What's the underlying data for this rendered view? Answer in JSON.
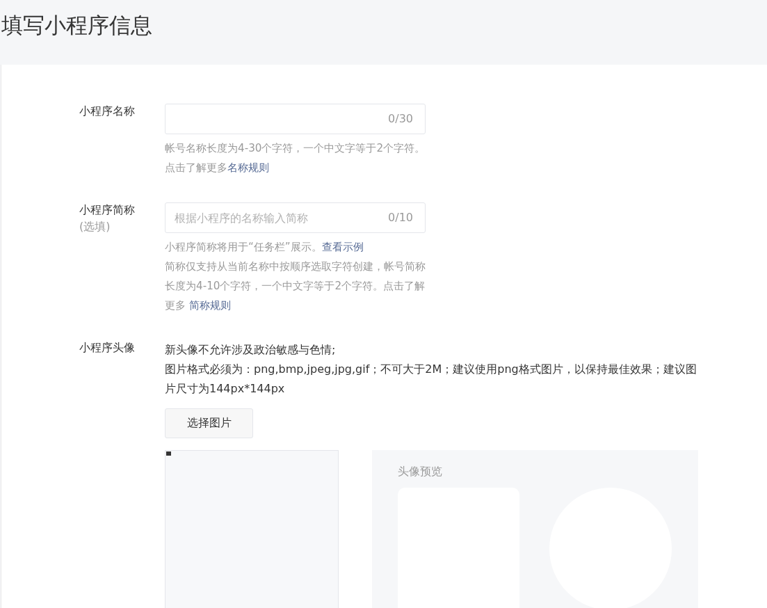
{
  "page_title": "填写小程序信息",
  "fields": [
    {
      "label": "小程序名称",
      "counter": "0/30",
      "hints": [
        {
          "text": "帐号名称长度为4-30个字符，一个中文字等于2个字符。点击了解更多",
          "link": "名称规则"
        }
      ]
    },
    {
      "label": "小程序简称",
      "sublabel": "(选填)",
      "placeholder": "根据小程序的名称输入简称",
      "counter": "0/10",
      "hints": [
        {
          "text": "小程序简称将用于“任务栏”展示。",
          "link": "查看示例"
        },
        {
          "text": "简称仅支持从当前名称中按顺序选取字符创建，帐号简称长度为4-10个字符，一个中文字等于2个字符。点击了解更多 ",
          "link": "简称规则"
        }
      ]
    }
  ],
  "avatar": {
    "label": "小程序头像",
    "notes": [
      "新头像不允许涉及政治敏感与色情;",
      "图片格式必须为：png,bmp,jpeg,jpg,gif；不可大于2M；建议使用png格式图片，以保持最佳效果；建议图片尺寸为144px*144px"
    ],
    "button": "选择图片",
    "preview_title": "头像预览"
  }
}
